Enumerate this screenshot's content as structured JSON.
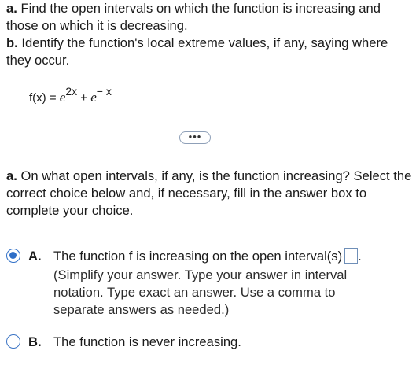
{
  "question": {
    "part_a_label": "a.",
    "part_a_text": " Find the open intervals on which the function is increasing and those on which it is decreasing.",
    "part_b_label": "b.",
    "part_b_text": " Identify the function's local extreme values, if any, saying where they occur."
  },
  "formula": {
    "lhs": "f(x) = ",
    "base1": "e",
    "exp1": "2x",
    "plus": " + ",
    "base2": "e",
    "exp2": "− x"
  },
  "divider": {
    "more_label": "•••"
  },
  "part_a": {
    "label": "a.",
    "text": " On what open intervals, if any, is the function increasing? Select the correct choice below and, if necessary, fill in the answer box to complete your choice."
  },
  "choices": [
    {
      "letter": "A.",
      "text": "The function f is increasing on the open interval(s)",
      "trailing": ".",
      "hint": "(Simplify your answer. Type your answer in interval notation. Type exact an answer. Use a comma to separate answers as needed.)",
      "selected": true
    },
    {
      "letter": "B.",
      "text": "The function is never increasing.",
      "selected": false
    }
  ],
  "colors": {
    "accent": "#2f6fc7",
    "divider": "#8a8a8a"
  }
}
